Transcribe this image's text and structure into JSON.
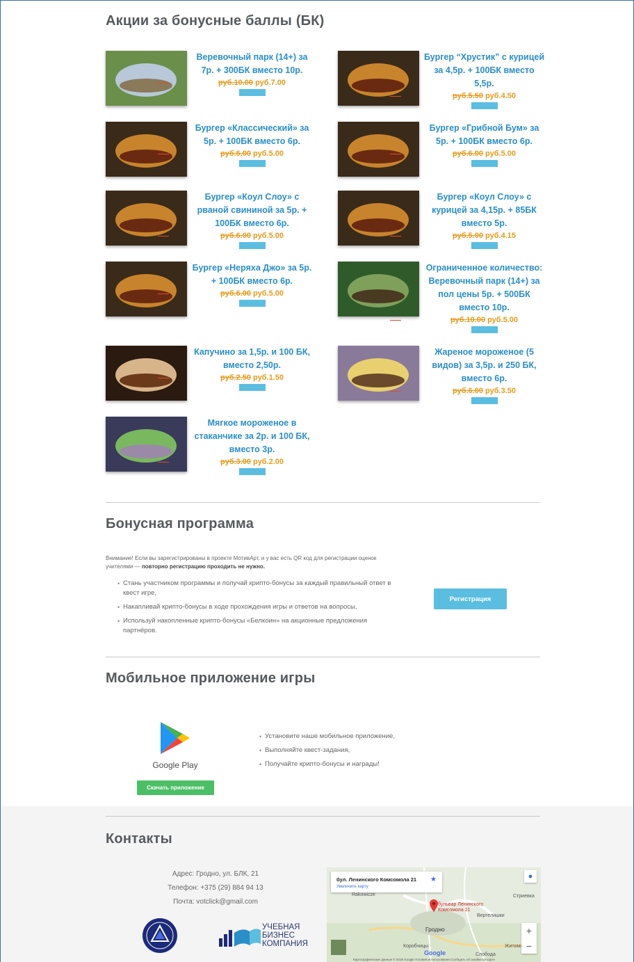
{
  "promotions": {
    "title": "Акции за бонусные баллы (БК)",
    "items": [
      {
        "name": "Веревочный парк (14+) за 7р. + 300БК вместо 10р.",
        "old": "руб.10.00",
        "new": "руб.7.00",
        "img": "park-photo"
      },
      {
        "name": "Бургер “Хрустик” с курицей за 4,5р. + 100БК вместо 5,5р.",
        "old": "руб.5.50",
        "new": "руб.4.50",
        "img": "burger-photo"
      },
      {
        "name": "Бургер «Классический» за 5р. + 100БК вместо 6р.",
        "old": "руб.6.00",
        "new": "руб.5.00",
        "img": "burger-photo"
      },
      {
        "name": "Бургер «Грибной Бум» за 5р. + 100БК вместо 6р.",
        "old": "руб.6.00",
        "new": "руб.5.00",
        "img": "burger-photo"
      },
      {
        "name": "Бургер «Коул Слоу» с рваной свининой за 5р. + 100БК вместо 6р.",
        "old": "руб.6.00",
        "new": "руб.5.00",
        "img": "burger-photo"
      },
      {
        "name": "Бургер «Коул Слоу» с курицей за 4,15р. + 85БК вместо 5р.",
        "old": "руб.5.00",
        "new": "руб.4.15",
        "img": "burger-photo"
      },
      {
        "name": "Бургер «Неряха Джо» за 5р. + 100БК вместо 6р.",
        "old": "руб.6.00",
        "new": "руб.5.00",
        "img": "burger-photo"
      },
      {
        "name": "Ограниченное количество: Веревочный парк (14+) за пол цены 5р. + 500БК вместо 10р.",
        "old": "руб.10.00",
        "new": "руб.5.00",
        "img": "forest-park-photo"
      },
      {
        "name": "Капучино за 1,5р. и 100 БК, вместо 2,50р.",
        "old": "руб.2.50",
        "new": "руб.1.50",
        "img": "coffee-photo"
      },
      {
        "name": "Жареное мороженое (5 видов) за 3,5р. и 250 БК, вместо 6р.",
        "old": "руб.6.00",
        "new": "руб.3.50",
        "img": "ice-cream-photo"
      },
      {
        "name": "Мягкое мороженое в стаканчике за 2р. и 100 БК, вместо 3р.",
        "old": "руб.3.00",
        "new": "руб.2.00",
        "img": "soft-ice-cream-photo"
      }
    ]
  },
  "bonus": {
    "title": "Бонусная программа",
    "note_prefix": "Внимание! Если вы зарегистрированы в проекте МотивАрт, и у вас есть QR код для регистрации оценок учителями — ",
    "note_bold": "повторно регистрацию проходить не нужно.",
    "bullets": [
      "Стань участником программы и получай крипто-бонусы за каждый правильный ответ в квест игре,",
      "Накапливай крипто-бонусы в ходе прохождения игры и ответов на вопросы,",
      "Используй накопленные крипто-бонусы «Белкоин» на акционные предложения партнёров."
    ],
    "register_label": "Регистрация"
  },
  "mobile": {
    "title": "Мобильное приложение игры",
    "store_label": "Google Play",
    "download_label": "Скачать приложение",
    "bullets": [
      "Установите наше мобильное приложение,",
      "Выполняйте квест-задания,",
      "Получайте крипто-бонусы и награды!"
    ]
  },
  "contacts": {
    "title": "Контакты",
    "address": "Адрес: Гродно, ул. БЛК, 21",
    "phone": "Телефон: +375 (29) 884 94 13",
    "email": "Почта: votclick@gmail.com",
    "partner_logo_text": [
      "УЧЕБНАЯ",
      "БИЗНЕС",
      "КОМПАНИЯ"
    ],
    "map": {
      "address": "бул. Ленинского Комсомола 21",
      "zoom_link": "Увеличить карту",
      "pin_label": "бульвар Ленинского Комсомола 21",
      "city": "Гродно",
      "labels": [
        "Коробчицы",
        "Стриевка",
        "Вертелишки",
        "Житомля",
        "Слобода",
        "Rakowicze"
      ],
      "attribution": "Картографические данные © 2019 Google   Условия использования   Сообщить об ошибке на карте",
      "google": "Google"
    }
  }
}
